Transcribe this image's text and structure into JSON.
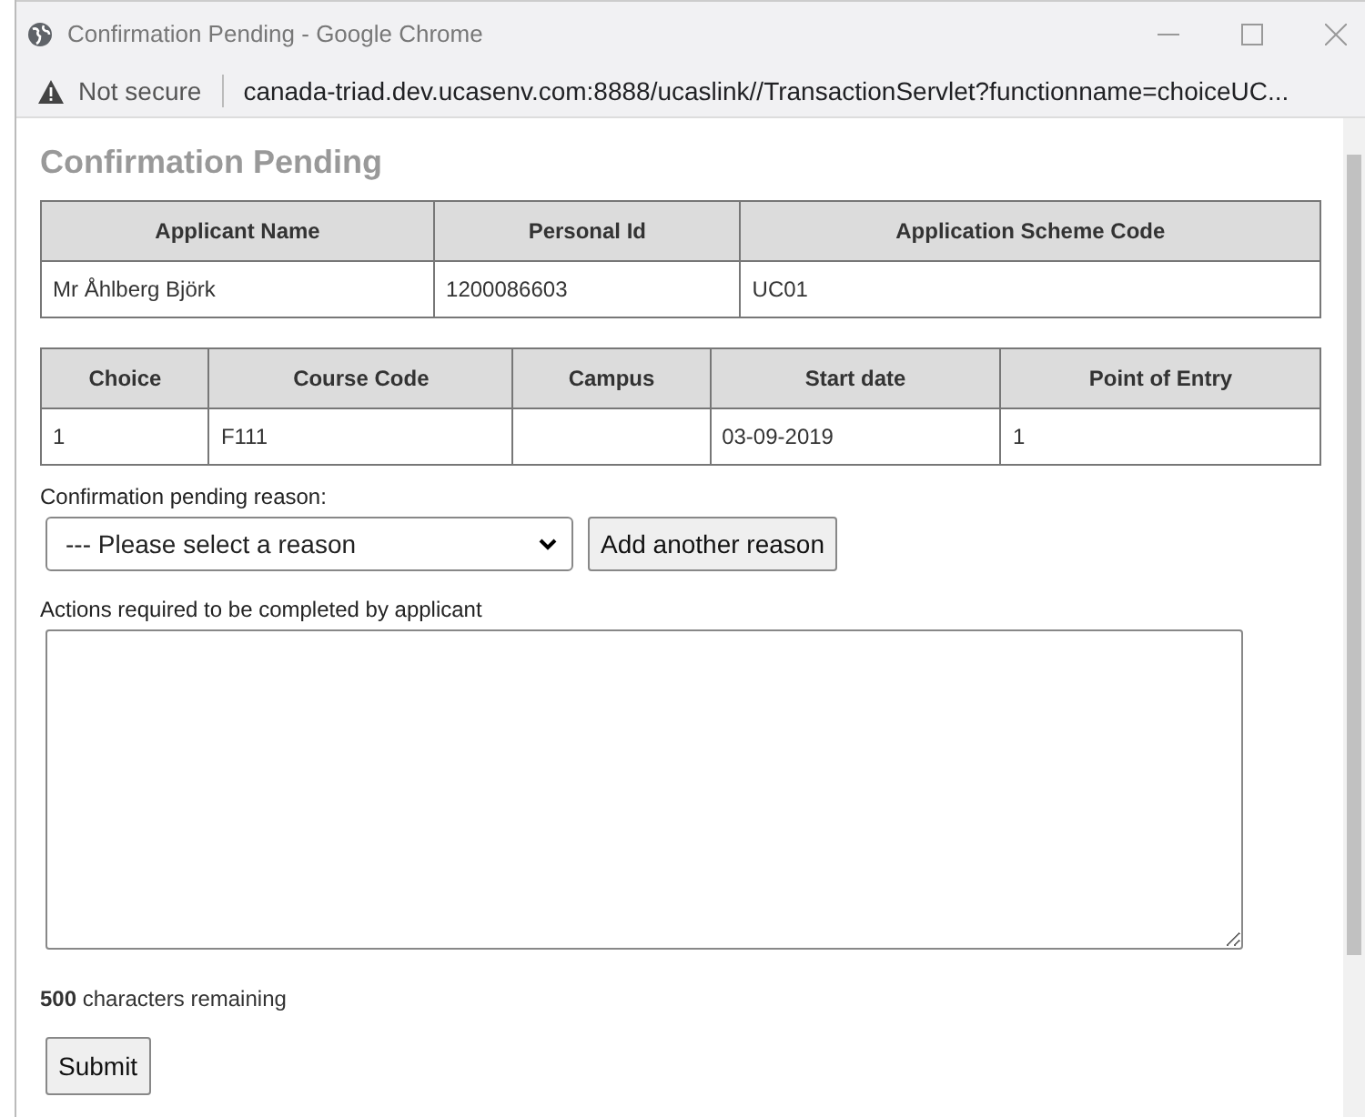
{
  "window": {
    "title": "Confirmation Pending - Google Chrome"
  },
  "address_bar": {
    "security": "Not secure",
    "url": "canada-triad.dev.ucasenv.com:8888/ucaslink//TransactionServlet?functionname=choiceUC..."
  },
  "page": {
    "heading": "Confirmation Pending",
    "applicant_table": {
      "columns": [
        "Applicant Name",
        "Personal Id",
        "Application Scheme Code"
      ],
      "rows": [
        [
          "Mr Åhlberg Björk",
          "1200086603",
          "UC01"
        ]
      ]
    },
    "choice_table": {
      "columns": [
        "Choice",
        "Course Code",
        "Campus",
        "Start date",
        "Point of Entry"
      ],
      "rows": [
        [
          "1",
          "F111",
          "",
          "03-09-2019",
          "1"
        ]
      ]
    },
    "reason_label": "Confirmation pending reason:",
    "reason_select": {
      "value": "--- Please select a reason"
    },
    "add_reason_button": "Add another reason",
    "actions_label": "Actions required to be completed by applicant",
    "chars_remaining": "**500** characters remaining",
    "submit_button": "Submit"
  }
}
